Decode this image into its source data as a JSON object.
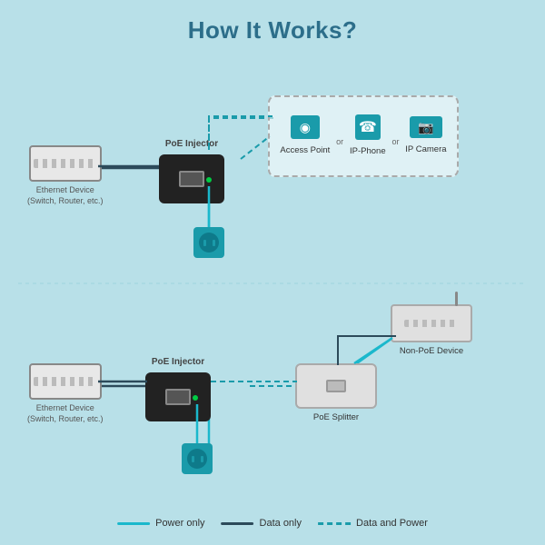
{
  "title": "How It Works?",
  "diagram": {
    "top_section": {
      "ethernet_device_label": "Ethernet Device\n(Switch, Router, etc.)",
      "poe_injector_label": "PoE Injector",
      "poe_devices_box": {
        "access_point_label": "Access Point",
        "or1": "or",
        "ip_phone_label": "IP-Phone",
        "or2": "or",
        "ip_camera_label": "IP Camera"
      }
    },
    "bottom_section": {
      "ethernet_device_label": "Ethernet Device\n(Switch, Router, etc.)",
      "poe_injector_label": "PoE Injector",
      "poe_splitter_label": "PoE Splitter",
      "non_poe_device_label": "Non-PoE Device"
    }
  },
  "legend": {
    "power_only_label": "Power only",
    "data_only_label": "Data only",
    "data_and_power_label": "Data and Power"
  }
}
